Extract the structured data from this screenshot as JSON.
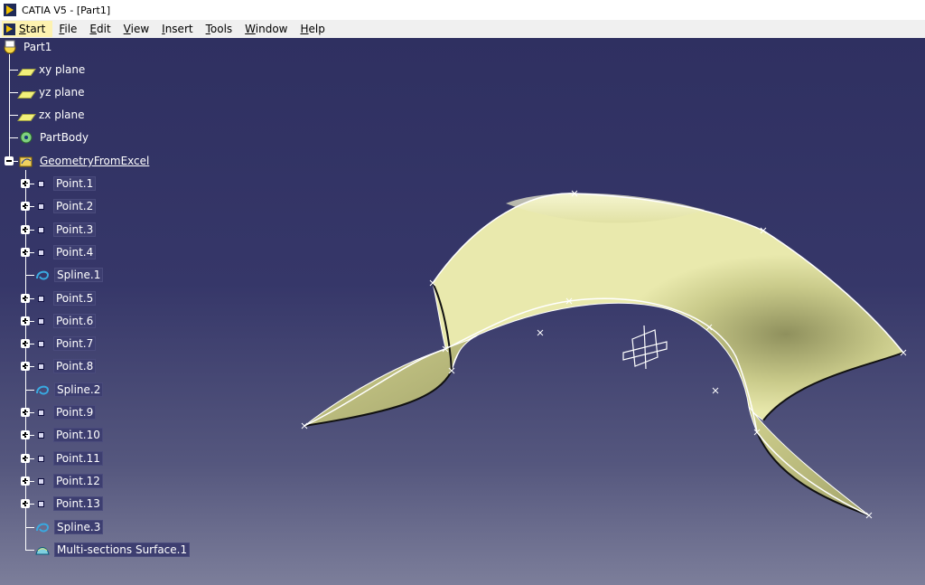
{
  "window": {
    "title": "CATIA V5 - [Part1]"
  },
  "menu": {
    "start": "Start",
    "items": [
      "File",
      "Edit",
      "View",
      "Insert",
      "Tools",
      "Window",
      "Help"
    ]
  },
  "tree": {
    "root": "Part1",
    "planes": [
      "xy plane",
      "yz plane",
      "zx plane"
    ],
    "body": "PartBody",
    "geo_set": "GeometryFromExcel",
    "children": [
      {
        "label": "Point.1",
        "icon": "point-icon"
      },
      {
        "label": "Point.2",
        "icon": "point-icon"
      },
      {
        "label": "Point.3",
        "icon": "point-icon"
      },
      {
        "label": "Point.4",
        "icon": "point-icon"
      },
      {
        "label": "Spline.1",
        "icon": "spline-icon"
      },
      {
        "label": "Point.5",
        "icon": "point-icon"
      },
      {
        "label": "Point.6",
        "icon": "point-icon"
      },
      {
        "label": "Point.7",
        "icon": "point-icon"
      },
      {
        "label": "Point.8",
        "icon": "point-icon"
      },
      {
        "label": "Spline.2",
        "icon": "spline-icon"
      },
      {
        "label": "Point.9",
        "icon": "point-icon"
      },
      {
        "label": "Point.10",
        "icon": "point-icon"
      },
      {
        "label": "Point.11",
        "icon": "point-icon"
      },
      {
        "label": "Point.12",
        "icon": "point-icon"
      },
      {
        "label": "Point.13",
        "icon": "point-icon"
      },
      {
        "label": "Spline.3",
        "icon": "spline-icon"
      },
      {
        "label": "Multi-sections Surface.1",
        "icon": "surface-icon"
      }
    ]
  },
  "colors": {
    "background": "#2e2f5e",
    "surface": "#eaeaa8",
    "surface_shade": "#9d9e68"
  }
}
